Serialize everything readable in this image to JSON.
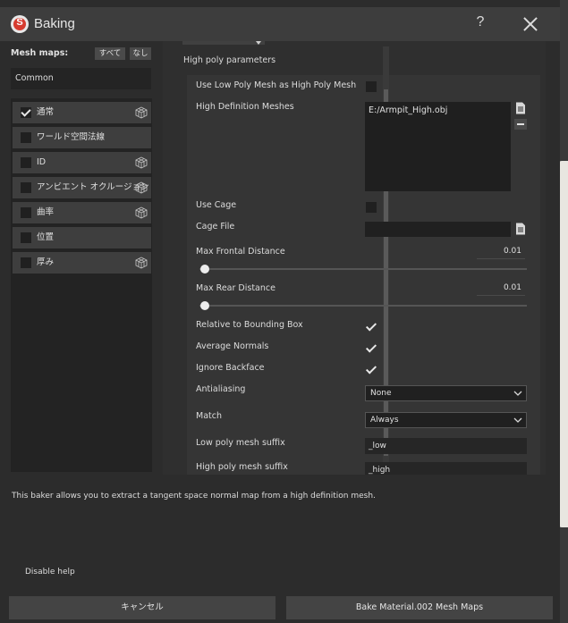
{
  "window": {
    "title": "Baking",
    "logo_letter": "S",
    "help_label": "?"
  },
  "left": {
    "mesh_maps_label": "Mesh maps:",
    "all_label": "すべて",
    "none_label": "なし",
    "common_label": "Common",
    "items": [
      {
        "label": "通常",
        "checked": true,
        "has_settings": true
      },
      {
        "label": "ワールド空間法線",
        "checked": false,
        "has_settings": false
      },
      {
        "label": "ID",
        "checked": false,
        "has_settings": true
      },
      {
        "label": "アンビエント オクルージョン",
        "checked": false,
        "has_settings": true
      },
      {
        "label": "曲率",
        "checked": false,
        "has_settings": true
      },
      {
        "label": "位置",
        "checked": false,
        "has_settings": false
      },
      {
        "label": "厚み",
        "checked": false,
        "has_settings": true
      }
    ]
  },
  "params": {
    "section_title": "High poly parameters",
    "use_low_poly": {
      "label": "Use Low Poly Mesh as High Poly Mesh",
      "checked": false
    },
    "high_def_meshes": {
      "label": "High Definition Meshes",
      "value": "E:/Armpit_High.obj"
    },
    "use_cage": {
      "label": "Use Cage",
      "checked": false
    },
    "cage_file": {
      "label": "Cage File",
      "value": ""
    },
    "max_frontal": {
      "label": "Max Frontal Distance",
      "value": "0.01",
      "fraction": 0.01
    },
    "max_rear": {
      "label": "Max Rear Distance",
      "value": "0.01",
      "fraction": 0.01
    },
    "relative_bbox": {
      "label": "Relative to Bounding Box",
      "checked": true
    },
    "average_normals": {
      "label": "Average Normals",
      "checked": true
    },
    "ignore_backface": {
      "label": "Ignore Backface",
      "checked": true
    },
    "antialiasing": {
      "label": "Antialiasing",
      "value": "None"
    },
    "match": {
      "label": "Match",
      "value": "Always"
    },
    "low_suffix": {
      "label": "Low poly mesh suffix",
      "value": "_low"
    },
    "high_suffix": {
      "label": "High poly mesh suffix",
      "value": "_high"
    }
  },
  "help": {
    "text": "This baker allows you to extract a tangent space normal map from a high definition mesh.",
    "disable_label": "Disable help"
  },
  "footer": {
    "cancel_label": "キャンセル",
    "bake_label": "Bake Material.002 Mesh Maps"
  },
  "colors": {
    "accent_logo": "#d63b2f",
    "panel_bg": "#2c2c2c",
    "title_bg": "#3d3d3d"
  }
}
